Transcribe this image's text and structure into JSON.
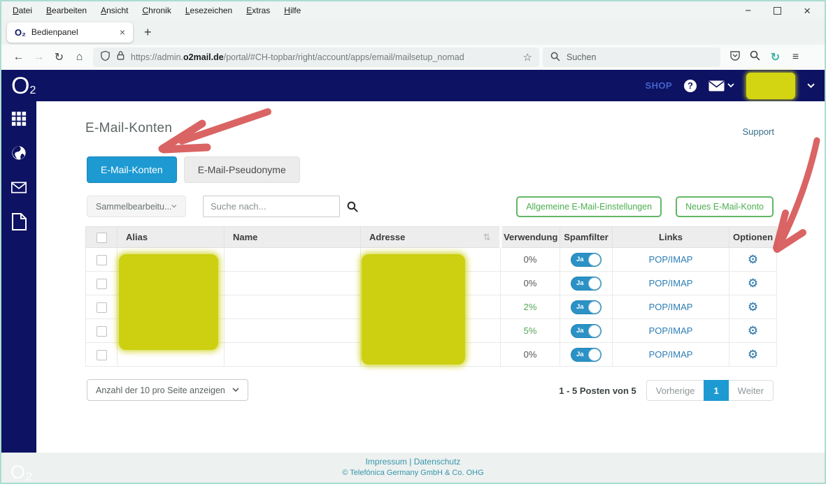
{
  "colors": {
    "accent_blue": "#1d9ad2",
    "navy": "#0d1263",
    "button_green": "#4cae4c",
    "redaction_yellow": "#ccd011",
    "annotation_red": "#d65454",
    "link_blue": "#2b7db5",
    "footer_teal": "#3795ab"
  },
  "browser": {
    "menu": [
      "Datei",
      "Bearbeiten",
      "Ansicht",
      "Chronik",
      "Lesezeichen",
      "Extras",
      "Hilfe"
    ],
    "window_controls": {
      "minimize": "−",
      "close": "×"
    },
    "tab": {
      "logo": "O₂",
      "title": "Bedienpanel",
      "close": "×",
      "new_tab": "+"
    },
    "toolbar": {
      "back": "←",
      "forward": "→",
      "refresh": "↻",
      "home": "⌂",
      "star": "☆",
      "restart": "↻",
      "hamburger": "≡"
    },
    "url": {
      "pre": "https://admin.",
      "host": "o2mail.de",
      "path": "/portal/#CH-topbar/right/account/apps/email/mailsetup_nomad"
    },
    "search_placeholder": "Suchen"
  },
  "header": {
    "logo_o": "O",
    "logo_sub": "2",
    "shop": "SHOP",
    "help_glyph": "?"
  },
  "page": {
    "title": "E-Mail-Konten",
    "support": "Support",
    "tab_active": "E-Mail-Konten",
    "tab_inactive": "E-Mail-Pseudonyme",
    "bulk_select": "Sammelbearbeitu...",
    "search_placeholder": "Suche nach...",
    "btn_settings": "Allgemeine E-Mail-Einstellungen",
    "btn_new": "Neues E-Mail-Konto",
    "table": {
      "headers": {
        "alias": "Alias",
        "name": "Name",
        "adresse": "Adresse",
        "verwendung": "Verwendung",
        "spamfilter": "Spamfilter",
        "links": "Links",
        "optionen": "Optionen"
      },
      "sort_glyph": "⇅",
      "gear_glyph": "⚙",
      "rows": [
        {
          "verwendung": "0%",
          "spamfilter": "Ja",
          "links": "POP/IMAP"
        },
        {
          "verwendung": "0%",
          "spamfilter": "Ja",
          "links": "POP/IMAP"
        },
        {
          "verwendung": "2%",
          "spamfilter": "Ja",
          "links": "POP/IMAP"
        },
        {
          "verwendung": "5%",
          "spamfilter": "Ja",
          "links": "POP/IMAP"
        },
        {
          "verwendung": "0%",
          "spamfilter": "Ja",
          "links": "POP/IMAP"
        }
      ]
    },
    "per_page": "Anzahl der 10 pro Seite anzeigen",
    "pagination": {
      "info": "1 - 5 Posten von 5",
      "prev": "Vorherige",
      "page": "1",
      "next": "Weiter"
    }
  },
  "footer": {
    "logo": "O₂",
    "impressum": "Impressum",
    "sep": "|",
    "datenschutz": "Datenschutz",
    "copyright": "© Telefónica Germany GmbH & Co. OHG"
  }
}
